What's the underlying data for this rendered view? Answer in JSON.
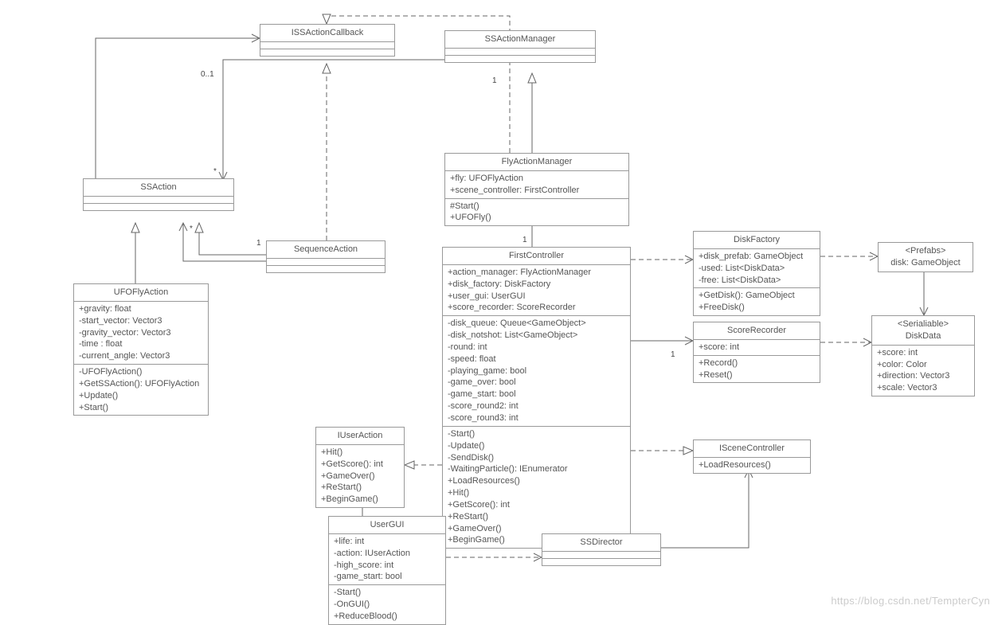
{
  "watermark": "https://blog.csdn.net/TempterCyn",
  "classes": {
    "ISSActionCallback": {
      "name": "ISSActionCallback",
      "sections": [
        {
          "empty": true
        },
        {
          "empty": true
        }
      ]
    },
    "SSActionManager": {
      "name": "SSActionManager",
      "sections": [
        {
          "empty": true
        },
        {
          "empty": true
        }
      ]
    },
    "SSAction": {
      "name": "SSAction",
      "sections": [
        {
          "empty": true
        },
        {
          "empty": true
        }
      ]
    },
    "SequenceAction": {
      "name": "SequenceAction",
      "sections": [
        {
          "empty": true
        },
        {
          "empty": true
        }
      ]
    },
    "FlyActionManager": {
      "name": "FlyActionManager",
      "attrs": "+fly: UFOFlyAction\n+scene_controller: FirstController",
      "ops": "#Start()\n+UFOFly()"
    },
    "UFOFlyAction": {
      "name": "UFOFlyAction",
      "attrs": "+gravity: float\n-start_vector: Vector3\n-gravity_vector: Vector3\n-time : float\n-current_angle: Vector3",
      "ops": "-UFOFlyAction()\n+GetSSAction(): UFOFlyAction\n+Update()\n+Start()"
    },
    "FirstController": {
      "name": "FirstController",
      "attrs1": "+action_manager: FlyActionManager\n+disk_factory: DiskFactory\n+user_gui: UserGUI\n+score_recorder: ScoreRecorder",
      "attrs2": "-disk_queue: Queue<GameObject>\n-disk_notshot: List<GameObject>\n-round: int\n-speed: float\n-playing_game: bool\n-game_over: bool\n-game_start: bool\n-score_round2: int\n-score_round3: int",
      "ops": "-Start()\n-Update()\n-SendDisk()\n-WaitingParticle(): IEnumerator\n+LoadResources()\n+Hit()\n+GetScore(): int\n+ReStart()\n+GameOver()\n+BeginGame()"
    },
    "DiskFactory": {
      "name": "DiskFactory",
      "attrs": "+disk_prefab: GameObject\n-used: List<DiskData>\n-free: List<DiskData>",
      "ops": "+GetDisk(): GameObject\n+FreeDisk()"
    },
    "Prefabs": {
      "name": "<Prefabs>\ndisk: GameObject"
    },
    "ScoreRecorder": {
      "name": "ScoreRecorder",
      "attrs": "+score: int",
      "ops": "+Record()\n+Reset()"
    },
    "DiskData": {
      "name": "<Serialiable>\nDiskData",
      "attrs": "+score: int\n+color: Color\n+direction: Vector3\n+scale: Vector3"
    },
    "IUserAction": {
      "name": "IUserAction",
      "ops": "+Hit()\n+GetScore(): int\n+GameOver()\n+ReStart()\n+BeginGame()"
    },
    "ISceneController": {
      "name": "ISceneController",
      "ops": "+LoadResources()"
    },
    "UserGUI": {
      "name": "UserGUI",
      "attrs": "+life: int\n-action: IUserAction\n-high_score: int\n-game_start: bool",
      "ops": "-Start()\n-OnGUI()\n+ReduceBlood()"
    },
    "SSDirector": {
      "name": "SSDirector",
      "sections": [
        {
          "empty": true
        },
        {
          "empty": true
        }
      ]
    }
  },
  "multiplicities": {
    "m0_1": "0..1",
    "star1": "*",
    "star2": "*",
    "one_seq": "1",
    "one_ssam": "1",
    "star_fly": "*",
    "one_fc": "1",
    "one_score": "1"
  }
}
